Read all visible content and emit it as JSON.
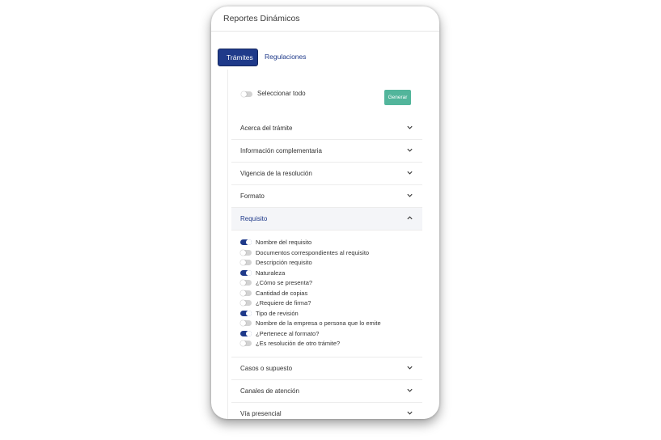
{
  "header": {
    "title": "Reportes Dinámicos"
  },
  "tabs": [
    {
      "label": "Trámites",
      "active": true
    },
    {
      "label": "Regulaciones",
      "active": false
    }
  ],
  "select_all": {
    "label": "Seleccionar todo",
    "on": false
  },
  "generate_button": {
    "label": "Generar"
  },
  "sections_top": [
    {
      "label": "Acerca del trámite",
      "icon": "chevron-down-icon"
    },
    {
      "label": "Información complementaria",
      "icon": "chevron-down-icon"
    },
    {
      "label": "Vigencia de la resolución",
      "icon": "chevron-down-icon"
    },
    {
      "label": "Formato",
      "icon": "chevron-down-icon"
    }
  ],
  "requisito": {
    "label": "Requisito",
    "icon": "chevron-up-icon",
    "items": [
      {
        "label": "Nombre del requisito",
        "on": true
      },
      {
        "label": "Documentos correspondientes al requisito",
        "on": false
      },
      {
        "label": "Descripción requisito",
        "on": false
      },
      {
        "label": "Naturaleza",
        "on": true
      },
      {
        "label": "¿Cómo se presenta?",
        "on": false
      },
      {
        "label": "Cantidad de copias",
        "on": false
      },
      {
        "label": "¿Requiere de firma?",
        "on": false
      },
      {
        "label": "Tipo de revisión",
        "on": true
      },
      {
        "label": "Nombre de la empresa o persona que lo emite",
        "on": false
      },
      {
        "label": "¿Pertenece al formato?",
        "on": true
      },
      {
        "label": "¿Es resolución de otro trámite?",
        "on": false
      }
    ]
  },
  "sections_bottom": [
    {
      "label": "Casos o supuesto",
      "icon": "chevron-down-icon"
    },
    {
      "label": "Canales de atención",
      "icon": "chevron-down-icon"
    },
    {
      "label": "Vía presencial",
      "icon": "chevron-down-icon"
    }
  ],
  "colors": {
    "primary": "#1f3a8a",
    "accent": "#52b59b",
    "toggle_off": "#d2d2d2"
  }
}
